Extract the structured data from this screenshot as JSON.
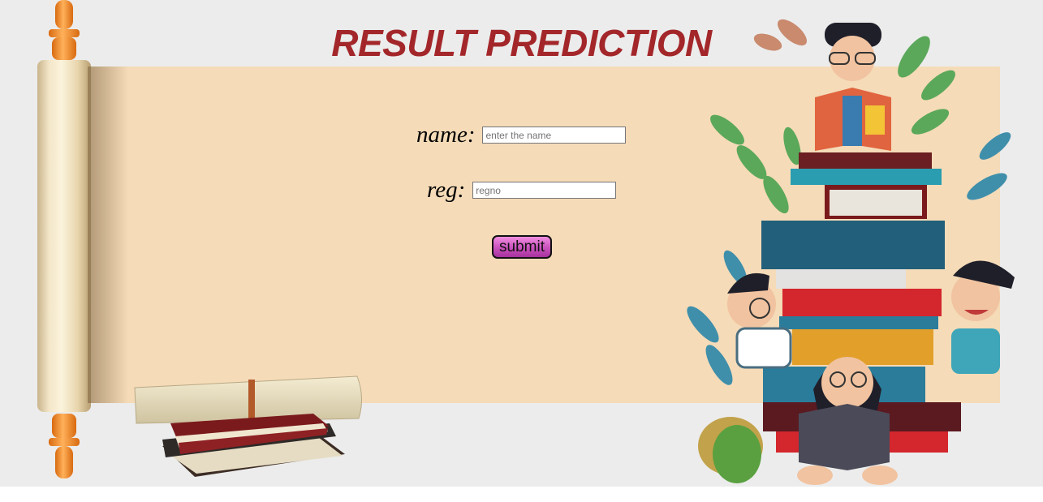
{
  "page": {
    "title": "RESULT PREDICTION"
  },
  "form": {
    "name_label": "name:",
    "name_placeholder": "enter the name",
    "name_value": "",
    "reg_label": "reg:",
    "reg_placeholder": "regno",
    "reg_value": "",
    "submit_label": "submit"
  },
  "colors": {
    "title": "#a3272a",
    "paper": "#f5dbb8",
    "background": "#ececec",
    "submit_button": "#cc55bf"
  },
  "icons": {
    "left_decoration": "book-stack-with-scroll",
    "right_decoration": "children-reading-on-books-illustration"
  }
}
